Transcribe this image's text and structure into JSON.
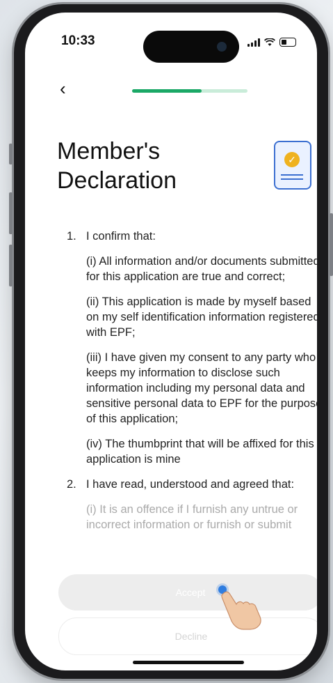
{
  "status_bar": {
    "time": "10:33",
    "signal_icon": "signal-bars-icon",
    "wifi_icon": "wifi-icon",
    "battery_icon": "battery-icon"
  },
  "header": {
    "back_icon": "chevron-left-icon",
    "back_glyph": "‹",
    "progress_fraction": 0.6,
    "progress_color": "#1aa866",
    "progress_track_color": "#c9ecd9"
  },
  "title": {
    "line1": "Member's",
    "line2": "Declaration",
    "icon": "document-check-icon"
  },
  "declaration": {
    "item1": {
      "number": "1.",
      "heading": "I confirm that:",
      "sub1": "(i) All information and/or documents submitted for this application are true and correct;",
      "sub2": "(ii) This application is made by myself based on my self identification information registered with EPF;",
      "sub3": "(iii) I have given my consent to any party who keeps my information to disclose such information including my personal data and sensitive personal data to EPF for the purpose of this application;",
      "sub4": "(iv) The thumbprint that will be affixed for this application is mine"
    },
    "item2": {
      "number": "2.",
      "heading": "I have read, understood and agreed that:",
      "sub1": "(i) It is an offence if I furnish any untrue or incorrect information or furnish or submit"
    }
  },
  "actions": {
    "accept_label": "Accept",
    "decline_label": "Decline"
  },
  "colors": {
    "accent": "#1aa866",
    "icon_blue": "#3b6fd1",
    "icon_gold": "#efb21f"
  }
}
